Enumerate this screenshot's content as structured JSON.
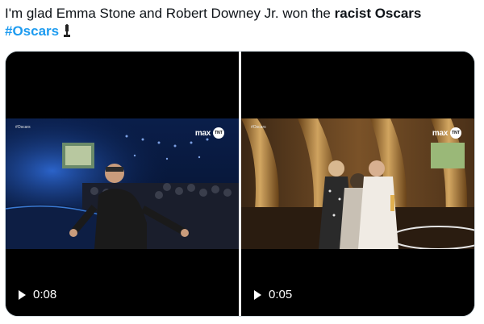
{
  "tweet": {
    "text_prefix": "I'm glad Emma Stone and Robert Downey Jr. won the ",
    "text_bold": "racist Oscars",
    "hashtag": "#Oscars"
  },
  "videos": [
    {
      "overlay_tag": "#Oscars",
      "brand": "max",
      "channel_badge": "TNT",
      "duration": "0:08"
    },
    {
      "overlay_tag": "#Oscars",
      "brand": "max",
      "channel_badge": "TNT",
      "duration": "0:05"
    }
  ],
  "icons": {
    "play": "play-icon",
    "emoji": "trophy-emoji"
  }
}
